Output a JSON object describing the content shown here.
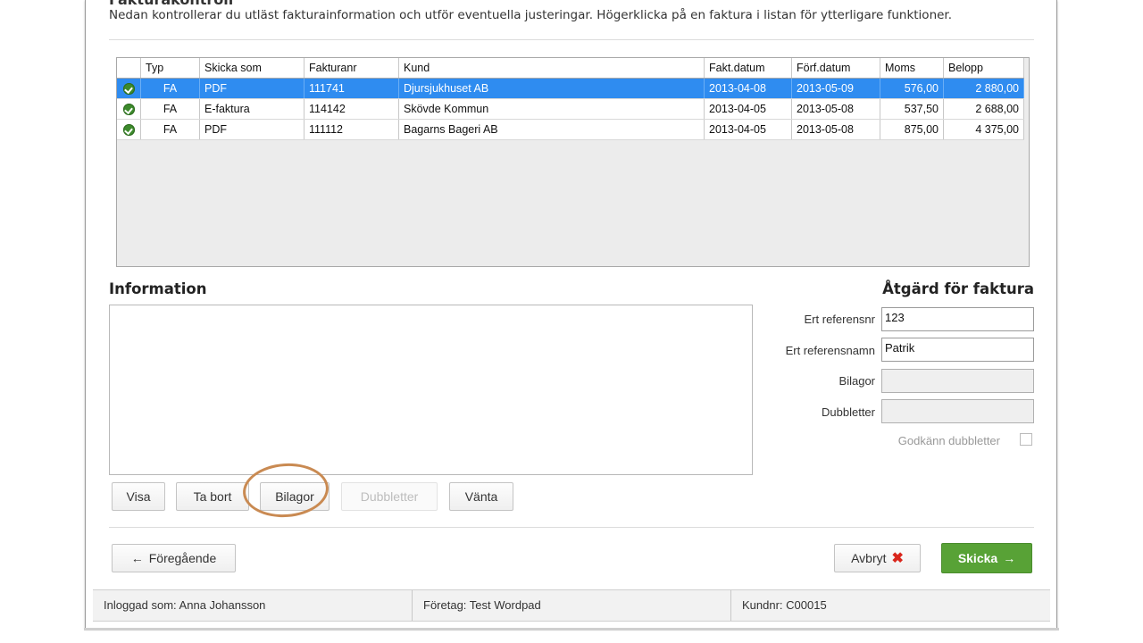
{
  "header": {
    "partial_title": "Fakturakontroll",
    "description": "Nedan kontrollerar du utläst fakturainformation och utför eventuella justeringar. Högerklicka på en faktura i listan för ytterligare funktioner."
  },
  "table": {
    "columns": [
      "",
      "Typ",
      "Skicka som",
      "Fakturanr",
      "Kund",
      "Fakt.datum",
      "Förf.datum",
      "Moms",
      "Belopp"
    ],
    "rows": [
      {
        "status": "ok-icon",
        "typ": "FA",
        "skicka_som": "PDF",
        "fakturanr": "111741",
        "kund": "Djursjukhuset AB",
        "fakt_datum": "2013-04-08",
        "forf_datum": "2013-05-09",
        "moms": "576,00",
        "belopp": "2 880,00",
        "selected": true
      },
      {
        "status": "ok-icon",
        "typ": "FA",
        "skicka_som": "E-faktura",
        "fakturanr": "114142",
        "kund": "Skövde Kommun",
        "fakt_datum": "2013-04-05",
        "forf_datum": "2013-05-08",
        "moms": "537,50",
        "belopp": "2 688,00",
        "selected": false
      },
      {
        "status": "ok-icon",
        "typ": "FA",
        "skicka_som": "PDF",
        "fakturanr": "111112",
        "kund": "Bagarns Bageri AB",
        "fakt_datum": "2013-04-05",
        "forf_datum": "2013-05-08",
        "moms": "875,00",
        "belopp": "4 375,00",
        "selected": false
      }
    ]
  },
  "information": {
    "title": "Information"
  },
  "action": {
    "title": "Åtgärd för faktura",
    "ref_nr_label": "Ert referensnr",
    "ref_nr_value": "123",
    "ref_name_label": "Ert referensnamn",
    "ref_name_value": "Patrik",
    "bilagor_label": "Bilagor",
    "dubbletter_label": "Dubbletter",
    "godkann_label": "Godkänn dubbletter"
  },
  "buttons": {
    "visa": "Visa",
    "ta_bort": "Ta bort",
    "bilagor": "Bilagor",
    "dubbletter": "Dubbletter",
    "vanta": "Vänta",
    "foregaende": "Föregående",
    "avbryt": "Avbryt",
    "skicka": "Skicka"
  },
  "status": {
    "user": "Inloggad som: Anna Johansson",
    "company": "Företag: Test Wordpad",
    "customer": "Kundnr: C00015"
  },
  "colors": {
    "selection": "#2f8cf0",
    "primary": "#58a236",
    "ok": "#3d8a2c",
    "cancel_x": "#d9261c",
    "highlight": "#c98a52"
  }
}
